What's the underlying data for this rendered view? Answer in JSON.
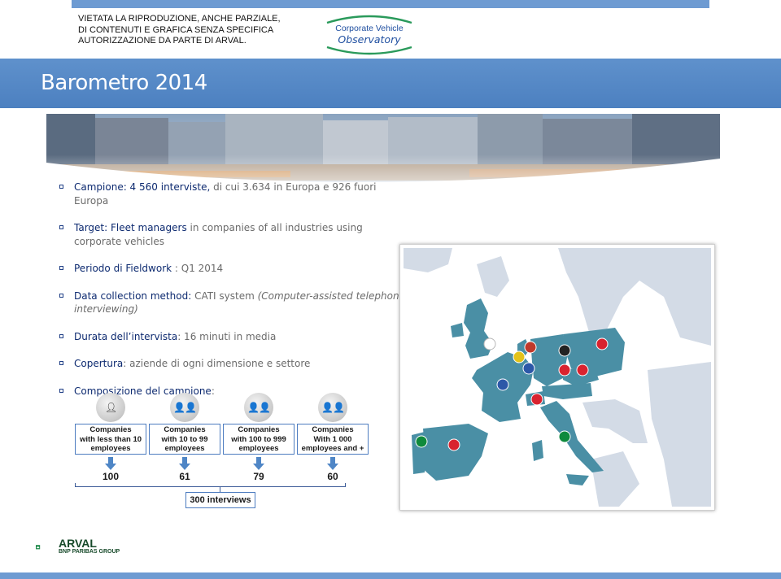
{
  "disclaimer": {
    "line1": "VIETATA LA RIPRODUZIONE, ANCHE PARZIALE,",
    "line2": "DI CONTENUTI E GRAFICA SENZA SPECIFICA",
    "line3": "AUTORIZZAZIONE DA PARTE DI ARVAL."
  },
  "cvo_logo": {
    "line1": "Corporate Vehicle",
    "line2": "Observatory",
    "icon": "cvo-logo-icon"
  },
  "title": "Barometro 2014",
  "bullets": [
    {
      "key": "Campione: 4 560 interviste,",
      "text": " di cui 3.634 in Europa e 926 fuori Europa"
    },
    {
      "key": "Target: Fleet managers",
      "text": " in companies of all industries using corporate vehicles"
    },
    {
      "key": "Periodo di Fieldwork",
      "text": " : Q1 2014"
    },
    {
      "key": "Data collection method:",
      "text": " CATI system ",
      "italic": "(Computer-assisted telephone interviewing)"
    },
    {
      "key": "Durata dell’intervista",
      "text": ": 16 minuti in media"
    },
    {
      "key": "Copertura",
      "text": ": aziende di ogni dimensione e settore"
    },
    {
      "key": "Composizione del campione",
      "text": ":"
    }
  ],
  "segments": [
    {
      "l1": "Companies",
      "l2": "with less than 10",
      "l3": "employees",
      "value": "100",
      "icon": "one-person-icon"
    },
    {
      "l1": "Companies",
      "l2": "with 10 to 99",
      "l3": "employees",
      "value": "61",
      "icon": "two-people-icon"
    },
    {
      "l1": "Companies",
      "l2": "with 100 to 999",
      "l3": "employees",
      "value": "79",
      "icon": "three-people-icon"
    },
    {
      "l1": "Companies",
      "l2": "With 1 000",
      "l3": "employees and +",
      "value": "60",
      "icon": "four-people-icon"
    }
  ],
  "total": "300 interviews",
  "map": {
    "countries": [
      "UK",
      "Netherlands",
      "Belgium",
      "France",
      "Germany",
      "Poland",
      "Czech Republic",
      "Austria",
      "Luxembourg",
      "Switzerland",
      "Italy",
      "Spain",
      "Portugal"
    ],
    "sea_color": "#ffffff",
    "land_color": "#d3dbe6",
    "highlight_color": "#4a8fa5"
  },
  "arval": {
    "name": "ARVAL",
    "group": "BNP PARIBAS GROUP",
    "icon": "arval-logo-icon",
    "color": "#174a2a"
  },
  "colors": {
    "title_bar": "#5a8cc8",
    "accent": "#1f3f86",
    "box_border": "#4d7cc0"
  }
}
